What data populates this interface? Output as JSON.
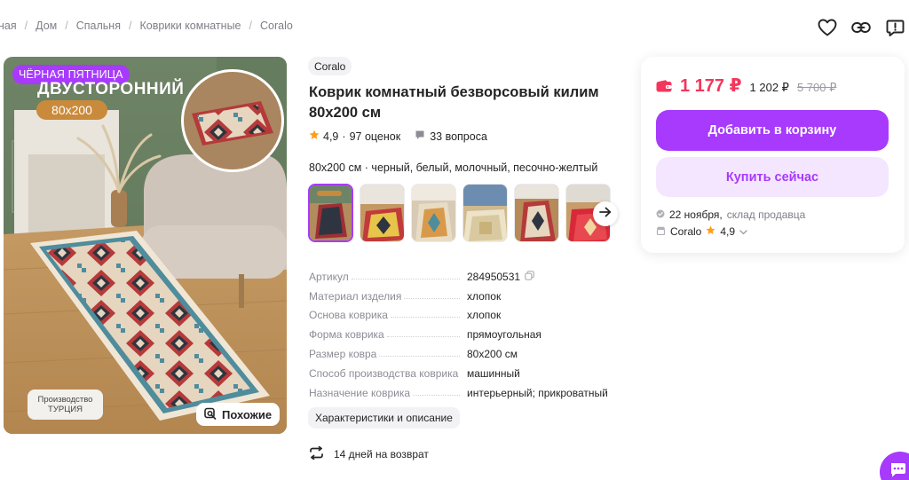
{
  "breadcrumb": [
    "ная",
    "Дом",
    "Спальня",
    "Коврики комнатные",
    "Coralo"
  ],
  "header_icons": [
    "heart-icon",
    "link-icon",
    "report-icon"
  ],
  "product_image": {
    "badge": "ЧЁРНАЯ ПЯТНИЦА",
    "promo_title": "ДВУСТОРОННИЙ",
    "promo_size": "80х200",
    "origin_line1": "Производство",
    "origin_line2": "ТУРЦИЯ",
    "similar_label": "Похожие"
  },
  "product": {
    "brand": "Coralo",
    "title": "Коврик комнатный безворсовый килим 80х200 см",
    "rating": "4,9",
    "reviews": "97 оценок",
    "questions": "33 вопроса",
    "variant": "80х200 см · черный, белый, молочный, песочно-желтый"
  },
  "specs": [
    {
      "label": "Артикул",
      "value": "284950531"
    },
    {
      "label": "Материал изделия",
      "value": "хлопок"
    },
    {
      "label": "Основа коврика",
      "value": "хлопок"
    },
    {
      "label": "Форма коврика",
      "value": "прямоугольная"
    },
    {
      "label": "Размер ковра",
      "value": "80х200 см"
    },
    {
      "label": "Способ производства коврика",
      "value": "машинный"
    },
    {
      "label": "Назначение коврика",
      "value": "интерьерный; прикроватный"
    }
  ],
  "characteristics_button": "Характеристики и описание",
  "return_policy": "14 дней на возврат",
  "buy_box": {
    "price": "1 177 ₽",
    "price_regular": "1 202 ₽",
    "price_old": "5 700 ₽",
    "add_to_cart": "Добавить в корзину",
    "buy_now": "Купить сейчас",
    "delivery_date": "22 ноября,",
    "delivery_source": "склад продавца",
    "seller": "Coralo",
    "seller_rating": "4,9"
  },
  "colors": {
    "accent": "#a73afd",
    "accent_light": "#f5e6ff",
    "price": "#f5365c",
    "star": "#ff9e18"
  }
}
